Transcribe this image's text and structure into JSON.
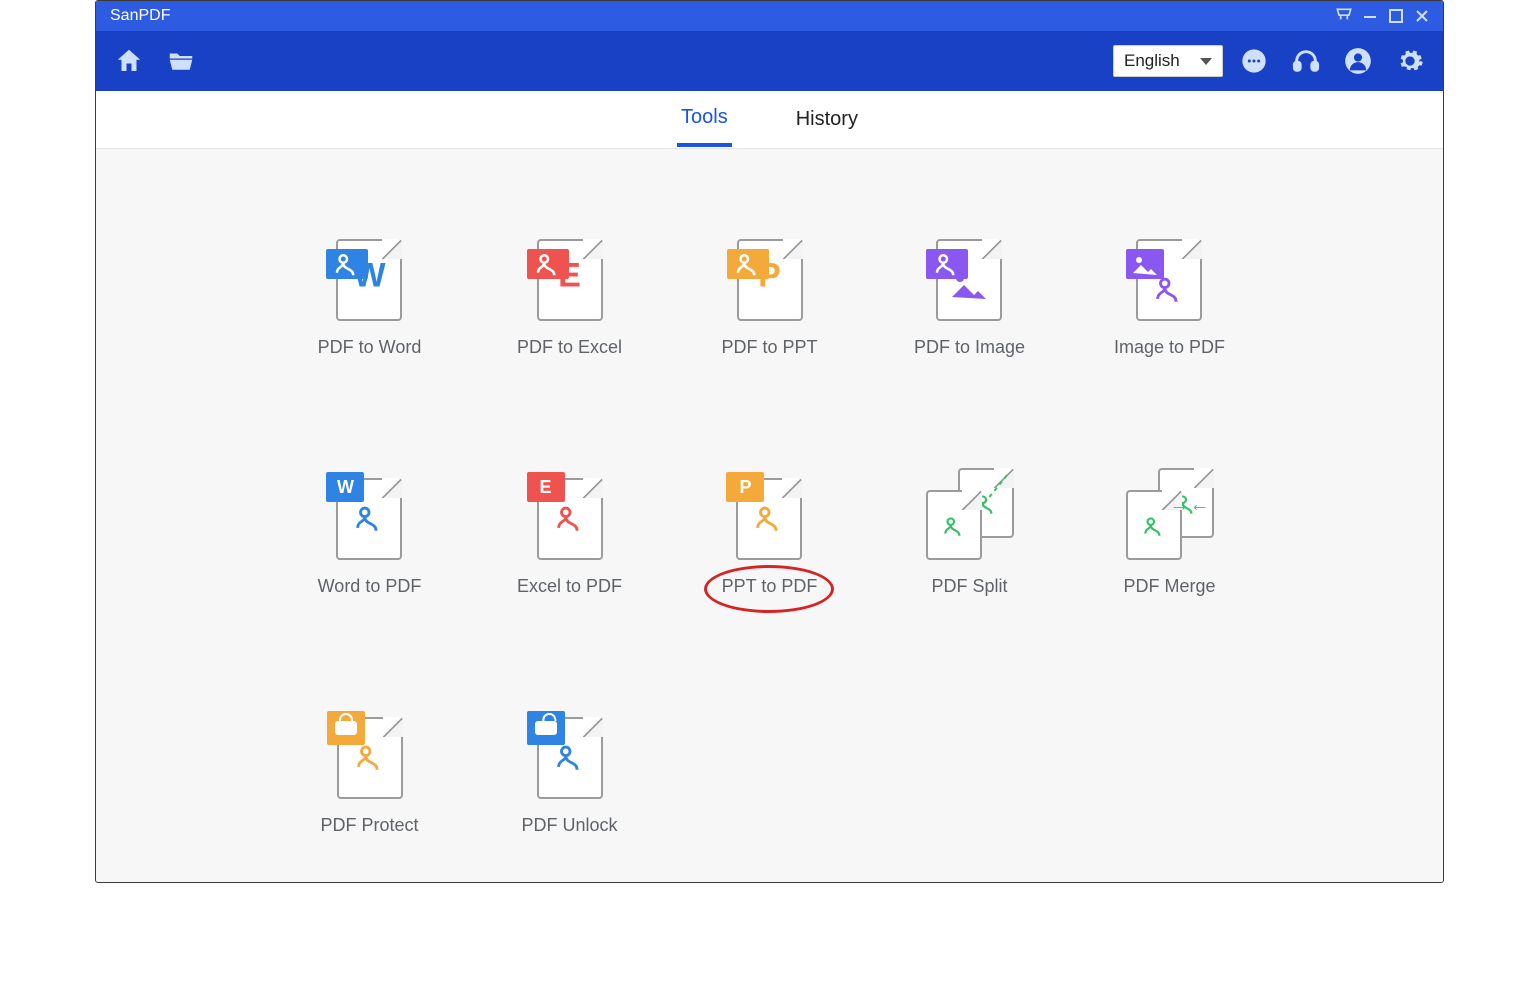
{
  "window": {
    "title": "SanPDF"
  },
  "toolbar": {
    "language": "English"
  },
  "tabs": {
    "tools": "Tools",
    "history": "History",
    "active": "tools"
  },
  "tools": {
    "pdf_to_word": "PDF to Word",
    "pdf_to_excel": "PDF to Excel",
    "pdf_to_ppt": "PDF to PPT",
    "pdf_to_image": "PDF to Image",
    "image_to_pdf": "Image to PDF",
    "word_to_pdf": "Word to PDF",
    "excel_to_pdf": "Excel to PDF",
    "ppt_to_pdf": "PPT to PDF",
    "pdf_split": "PDF Split",
    "pdf_merge": "PDF Merge",
    "pdf_protect": "PDF Protect",
    "pdf_unlock": "PDF Unlock"
  },
  "letters": {
    "w": "W",
    "e": "E",
    "p": "P"
  },
  "annotation": {
    "highlighted_tool": "ppt_to_pdf"
  },
  "colors": {
    "brand": "#1841c6",
    "word": "#2f84e3",
    "excel": "#ef5350",
    "ppt": "#f4a93b",
    "image": "#8a57f0",
    "green": "#37c168"
  }
}
